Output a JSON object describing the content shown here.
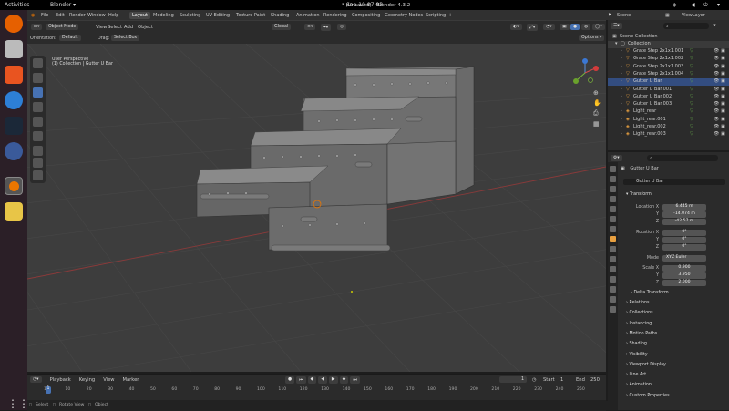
{
  "ubuntu_bar": {
    "activities": "Activities",
    "app": "Blender ▾",
    "clock": "Sep 10  07:03"
  },
  "window_title": "* (Unsaved) - Blender 4.3.2",
  "menus": [
    "File",
    "Edit",
    "Render",
    "Window",
    "Help"
  ],
  "workspaces": [
    "Layout",
    "Modeling",
    "Sculpting",
    "UV Editing",
    "Texture Paint",
    "Shading",
    "Animation",
    "Rendering",
    "Compositing",
    "Geometry Nodes",
    "Scripting"
  ],
  "scene": "Scene",
  "view_layer": "ViewLayer",
  "viewport_header": {
    "mode": "Object Mode",
    "menus": [
      "View",
      "Select",
      "Add",
      "Object"
    ],
    "transform": "Global",
    "orientation_label": "Orientation:",
    "orientation": "Default",
    "drag_label": "Drag:",
    "drag": "Select Box",
    "options": "Options ▾"
  },
  "viewport_info": {
    "line1": "User Perspective",
    "line2": "(1) Collection | Gutter U Bar"
  },
  "timeline": {
    "menus": [
      "Playback",
      "Keying",
      "View",
      "Marker"
    ],
    "current_frame": "1",
    "start_label": "Start",
    "start": "1",
    "end_label": "End",
    "end": "250",
    "ticks": [
      "1",
      "10",
      "20",
      "30",
      "40",
      "50",
      "60",
      "70",
      "80",
      "90",
      "100",
      "110",
      "120",
      "130",
      "140",
      "150",
      "160",
      "170",
      "180",
      "190",
      "200",
      "210",
      "220",
      "230",
      "240",
      "250"
    ]
  },
  "statusbar": {
    "select": "Select",
    "rotate": "Rotate View",
    "object": "Object",
    "version": "4.3.2"
  },
  "outliner": {
    "root": "Scene Collection",
    "collection": "Collection",
    "items": [
      "Grate Step 2x1x1.001",
      "Grate Step 2x1x1.002",
      "Grate Step 2x1x1.003",
      "Grate Step 2x1x1.004",
      "Gutter U Bar",
      "Gutter U Bar.001",
      "Gutter U Bar.002",
      "Gutter U Bar.003",
      "Light_rear",
      "Light_rear.001",
      "Light_rear.002",
      "Light_rear.003"
    ],
    "selected_index": 4
  },
  "properties": {
    "object_name": "Gutter U Bar",
    "name_field": "Gutter U Bar",
    "transform_title": "Transform",
    "location_label": "Location X",
    "location": [
      "6.445 m",
      "-14.074 m",
      "-42.57 m"
    ],
    "rotation_label": "Rotation X",
    "rotation": [
      "0°",
      "0°",
      "0°"
    ],
    "mode_label": "Mode",
    "mode": "XYZ Euler",
    "scale_label": "Scale X",
    "scale": [
      "0.900",
      "3.950",
      "2.000"
    ],
    "axis_y": "Y",
    "axis_z": "Z",
    "delta": "Delta Transform",
    "sections": [
      "Relations",
      "Collections",
      "Instancing",
      "Motion Paths",
      "Shading",
      "Visibility",
      "Viewport Display",
      "Line Art",
      "Animation",
      "Custom Properties"
    ]
  }
}
